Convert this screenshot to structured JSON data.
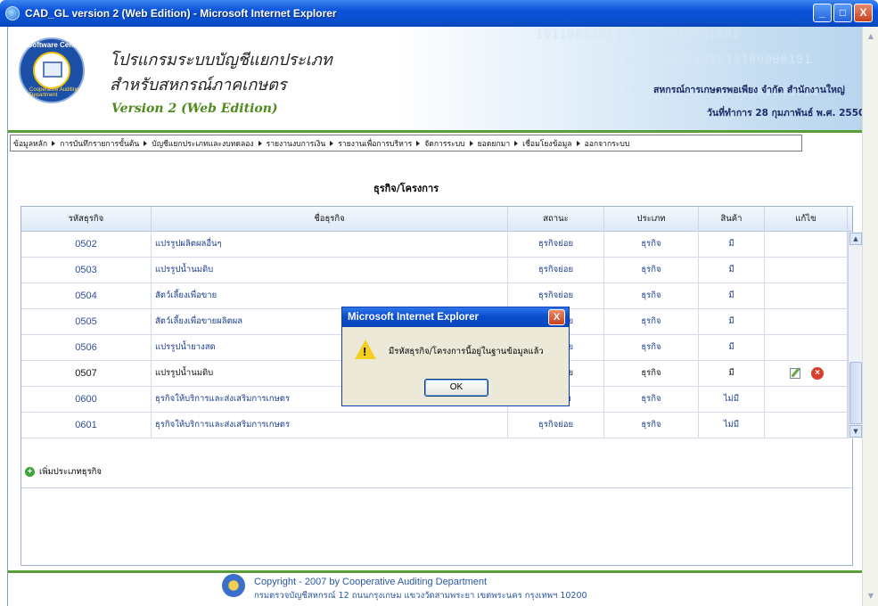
{
  "window": {
    "title": "CAD_GL version 2 (Web Edition) - Microsoft Internet Explorer",
    "minimize": "_",
    "maximize": "□",
    "close": "X"
  },
  "header": {
    "logo_text": "Software Center",
    "logo_bottom_text": "Cooperative Auditing Department",
    "program_title_line1": "โปรแกรมระบบบัญชีแยกประเภท",
    "program_title_line2": "สำหรับสหกรณ์ภาคเกษตร",
    "version": "Version 2 (Web Edition)",
    "organization": "สหกรณ์การเกษตรพอเพียง จำกัด สำนักงานใหญ่",
    "transaction_date": "วันที่ทำการ 28 กุมภาพันธ์ พ.ศ. 2550",
    "binary_line1": "10110011011100110010101001",
    "binary_line2": "100010001100011100000101",
    "binary_line3": "1000100011000101101001010"
  },
  "menu": [
    "ข้อมูลหลัก",
    "การบันทึกรายการขั้นต้น",
    "บัญชีแยกประเภทและงบทดลอง",
    "รายงานงบการเงิน",
    "รายงานเพื่อการบริหาร",
    "จัดการระบบ",
    "ยอดยกมา",
    "เชื่อมโยงข้อมูล",
    "ออกจากระบบ"
  ],
  "page_heading": "ธุรกิจ/โครงการ",
  "grid": {
    "columns": [
      "รหัสธุรกิจ",
      "ชื่อธุรกิจ",
      "สถานะ",
      "ประเภท",
      "สินค้า",
      "แก้ไข"
    ],
    "rows": [
      {
        "code": "0502",
        "name": "แปรรูปผลิตผลอื่นๆ",
        "status": "ธุรกิจย่อย",
        "type": "ธุรกิจ",
        "product": "มี"
      },
      {
        "code": "0503",
        "name": "แปรรูปน้ำนมดิบ",
        "status": "ธุรกิจย่อย",
        "type": "ธุรกิจ",
        "product": "มี"
      },
      {
        "code": "0504",
        "name": "สัตว์เลี้ยงเพื่อขาย",
        "status": "ธุรกิจย่อย",
        "type": "ธุรกิจ",
        "product": "มี"
      },
      {
        "code": "0505",
        "name": "สัตว์เลี้ยงเพื่อขายผลิตผล",
        "status": "ธุรกิจย่อย",
        "type": "ธุรกิจ",
        "product": "มี"
      },
      {
        "code": "0506",
        "name": "แปรรูปน้ำยางสด",
        "status": "ธุรกิจย่อย",
        "type": "ธุรกิจ",
        "product": "มี"
      },
      {
        "code": "0507",
        "name": "แปรรูปน้ำนมดิบ",
        "status": "ธุรกิจย่อย",
        "type": "ธุรกิจ",
        "product": "มี"
      },
      {
        "code": "0600",
        "name": "ธุรกิจให้บริการและส่งเสริมการเกษตร",
        "status": "ธุรกิจคุม",
        "type": "ธุรกิจ",
        "product": "ไม่มี"
      },
      {
        "code": "0601",
        "name": "ธุรกิจให้บริการและส่งเสริมการเกษตร",
        "status": "ธุรกิจย่อย",
        "type": "ธุรกิจ",
        "product": "ไม่มี"
      }
    ],
    "add_label": "เพิ่มประเภทธุรกิจ",
    "delete_glyph": "×",
    "add_glyph": "+"
  },
  "footer": {
    "copyright": "Copyright - 2007 by Cooperative Auditing Department",
    "address": "กรมตรวจบัญชีสหกรณ์ 12 ถนนกรุงเกษม แขวงวัดสามพระยา เขตพระนคร กรุงเทพฯ 10200"
  },
  "dialog": {
    "title": "Microsoft Internet Explorer",
    "message": "มีรหัสธุรกิจ/โครงการนี้อยู่ในฐานข้อมูลแล้ว",
    "ok_label": "OK",
    "close": "X",
    "warn_glyph": "!"
  },
  "scroll": {
    "up": "▲",
    "down": "▼"
  }
}
